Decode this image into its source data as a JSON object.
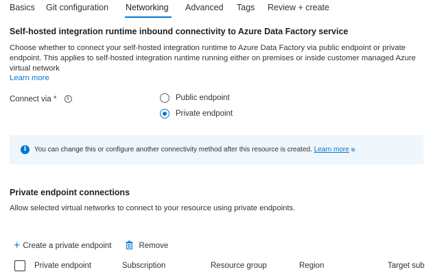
{
  "tabs": [
    {
      "label": "Basics"
    },
    {
      "label": "Git configuration"
    },
    {
      "label": "Networking"
    },
    {
      "label": "Advanced"
    },
    {
      "label": "Tags"
    },
    {
      "label": "Review + create"
    }
  ],
  "active_tab": "Networking",
  "inbound": {
    "heading": "Self-hosted integration runtime inbound connectivity to Azure Data Factory service",
    "description_line1": "Choose whether to connect your self-hosted integration runtime to Azure Data Factory via public endpoint or private",
    "description_line2": "endpoint. This applies to self-hosted integration runtime running either on premises or inside customer managed Azure",
    "description_line3": "virtual network",
    "learn_more": "Learn more"
  },
  "connect_via": {
    "label": "Connect via",
    "required_mark": "*",
    "info_glyph": "i",
    "options": [
      {
        "label": "Public endpoint",
        "checked": false
      },
      {
        "label": "Private endpoint",
        "checked": true
      }
    ]
  },
  "info_bar": {
    "icon": "info-icon",
    "icon_glyph": "i",
    "text": "You can change this or configure another connectivity method after this resource is created.",
    "link": "Learn more",
    "link_icon": "external-link-icon",
    "accent": "#0078d4",
    "background": "#eff6fc"
  },
  "private_endpoints": {
    "heading": "Private endpoint connections",
    "description": "Allow selected virtual networks to connect to your resource using private endpoints.",
    "commands": [
      {
        "label": "Create a private endpoint",
        "icon": "plus-icon"
      },
      {
        "label": "Remove",
        "icon": "trash-icon"
      }
    ],
    "columns": [
      "Private endpoint",
      "Subscription",
      "Resource group",
      "Region",
      "Target sub"
    ]
  }
}
